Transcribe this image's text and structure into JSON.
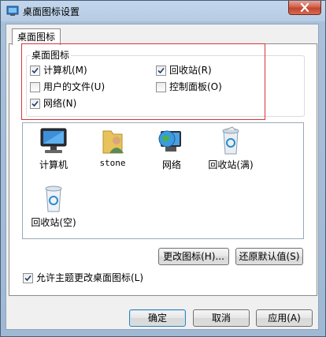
{
  "window": {
    "title": "桌面图标设置"
  },
  "tab": {
    "label": "桌面图标"
  },
  "group": {
    "label": "桌面图标",
    "checkboxes": [
      {
        "label": "计算机(M)",
        "checked": true
      },
      {
        "label": "回收站(R)",
        "checked": true
      },
      {
        "label": "用户的文件(U)",
        "checked": false
      },
      {
        "label": "控制面板(O)",
        "checked": false
      },
      {
        "label": "网络(N)",
        "checked": true
      }
    ]
  },
  "icons": [
    {
      "label": "计算机",
      "icon": "computer-icon"
    },
    {
      "label": "stone",
      "icon": "user-folder-icon"
    },
    {
      "label": "网络",
      "icon": "network-globe-icon"
    },
    {
      "label": "回收站(满)",
      "icon": "recycle-bin-full-icon"
    },
    {
      "label": "回收站(空)",
      "icon": "recycle-bin-empty-icon"
    }
  ],
  "buttons": {
    "change_icon": "更改图标(H)...",
    "restore_default": "还原默认值(S)",
    "ok": "确定",
    "cancel": "取消",
    "apply": "应用(A)"
  },
  "theme_checkbox": {
    "label": "允许主题更改桌面图标(L)",
    "checked": true
  },
  "colors": {
    "highlight_box": "#d9343a",
    "default_button_border": "#3c7fb1",
    "close_button": "#c3442d"
  }
}
